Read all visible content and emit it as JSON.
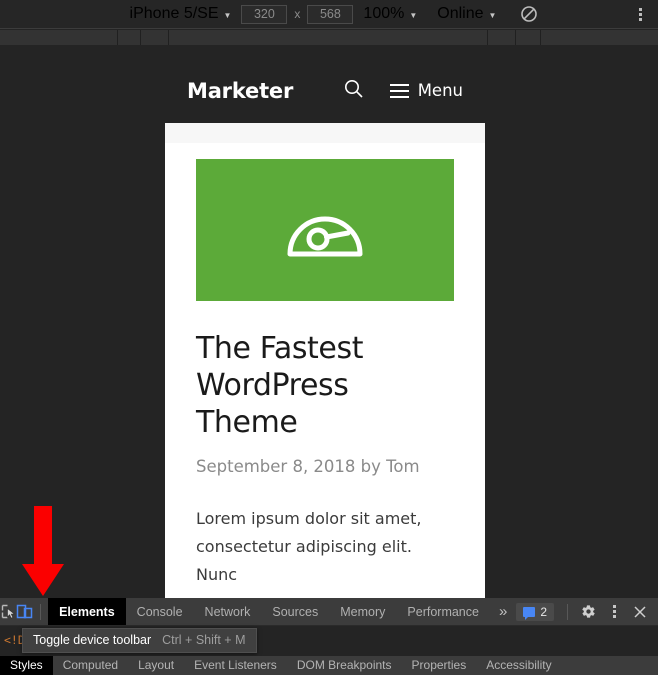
{
  "device_toolbar": {
    "device_name": "iPhone 5/SE",
    "width_value": "320",
    "height_value": "568",
    "dimension_separator": "x",
    "zoom_value": "100%",
    "throttling_value": "Online",
    "throttle_icon": "no-throttling-icon",
    "caret": "▼",
    "more_options_icon": "vertical-dots-icon"
  },
  "website": {
    "logo": "Marketer",
    "search_icon": "search-icon",
    "menu_icon": "hamburger-icon",
    "menu_label": "Menu",
    "hero_icon": "speedometer-icon",
    "hero_bg_color": "#5caa39",
    "post_title": "The Fastest WordPress Theme",
    "post_meta": "September 8, 2018 by Tom",
    "post_body": "Lorem ipsum dolor sit amet, consectetur adipiscing elit. Nunc"
  },
  "annotation": {
    "arrow_color": "#fb0000",
    "arrow_target": "toggle-device-toolbar-button"
  },
  "devtools": {
    "inspect_icon": "inspect-element-icon",
    "device_toolbar_icon": "toggle-device-toolbar-icon",
    "tabs": [
      {
        "label": "Elements",
        "active": true
      },
      {
        "label": "Console",
        "active": false
      },
      {
        "label": "Network",
        "active": false
      },
      {
        "label": "Sources",
        "active": false
      },
      {
        "label": "Memory",
        "active": false
      },
      {
        "label": "Performance",
        "active": false
      }
    ],
    "more_tabs_icon": "»",
    "message_count": "2",
    "message_icon": "message-bubble-icon",
    "settings_icon": "gear-icon",
    "main_menu_icon": "vertical-dots-icon",
    "close_icon": "close-icon",
    "doctype_snippet": "<!D",
    "tooltip": {
      "text": "Toggle device toolbar",
      "shortcut": "Ctrl + Shift + M"
    },
    "sub_tabs": [
      {
        "label": "Styles",
        "active": true
      },
      {
        "label": "Computed",
        "active": false
      },
      {
        "label": "Layout",
        "active": false
      },
      {
        "label": "Event Listeners",
        "active": false
      },
      {
        "label": "DOM Breakpoints",
        "active": false
      },
      {
        "label": "Properties",
        "active": false
      },
      {
        "label": "Accessibility",
        "active": false
      }
    ]
  }
}
